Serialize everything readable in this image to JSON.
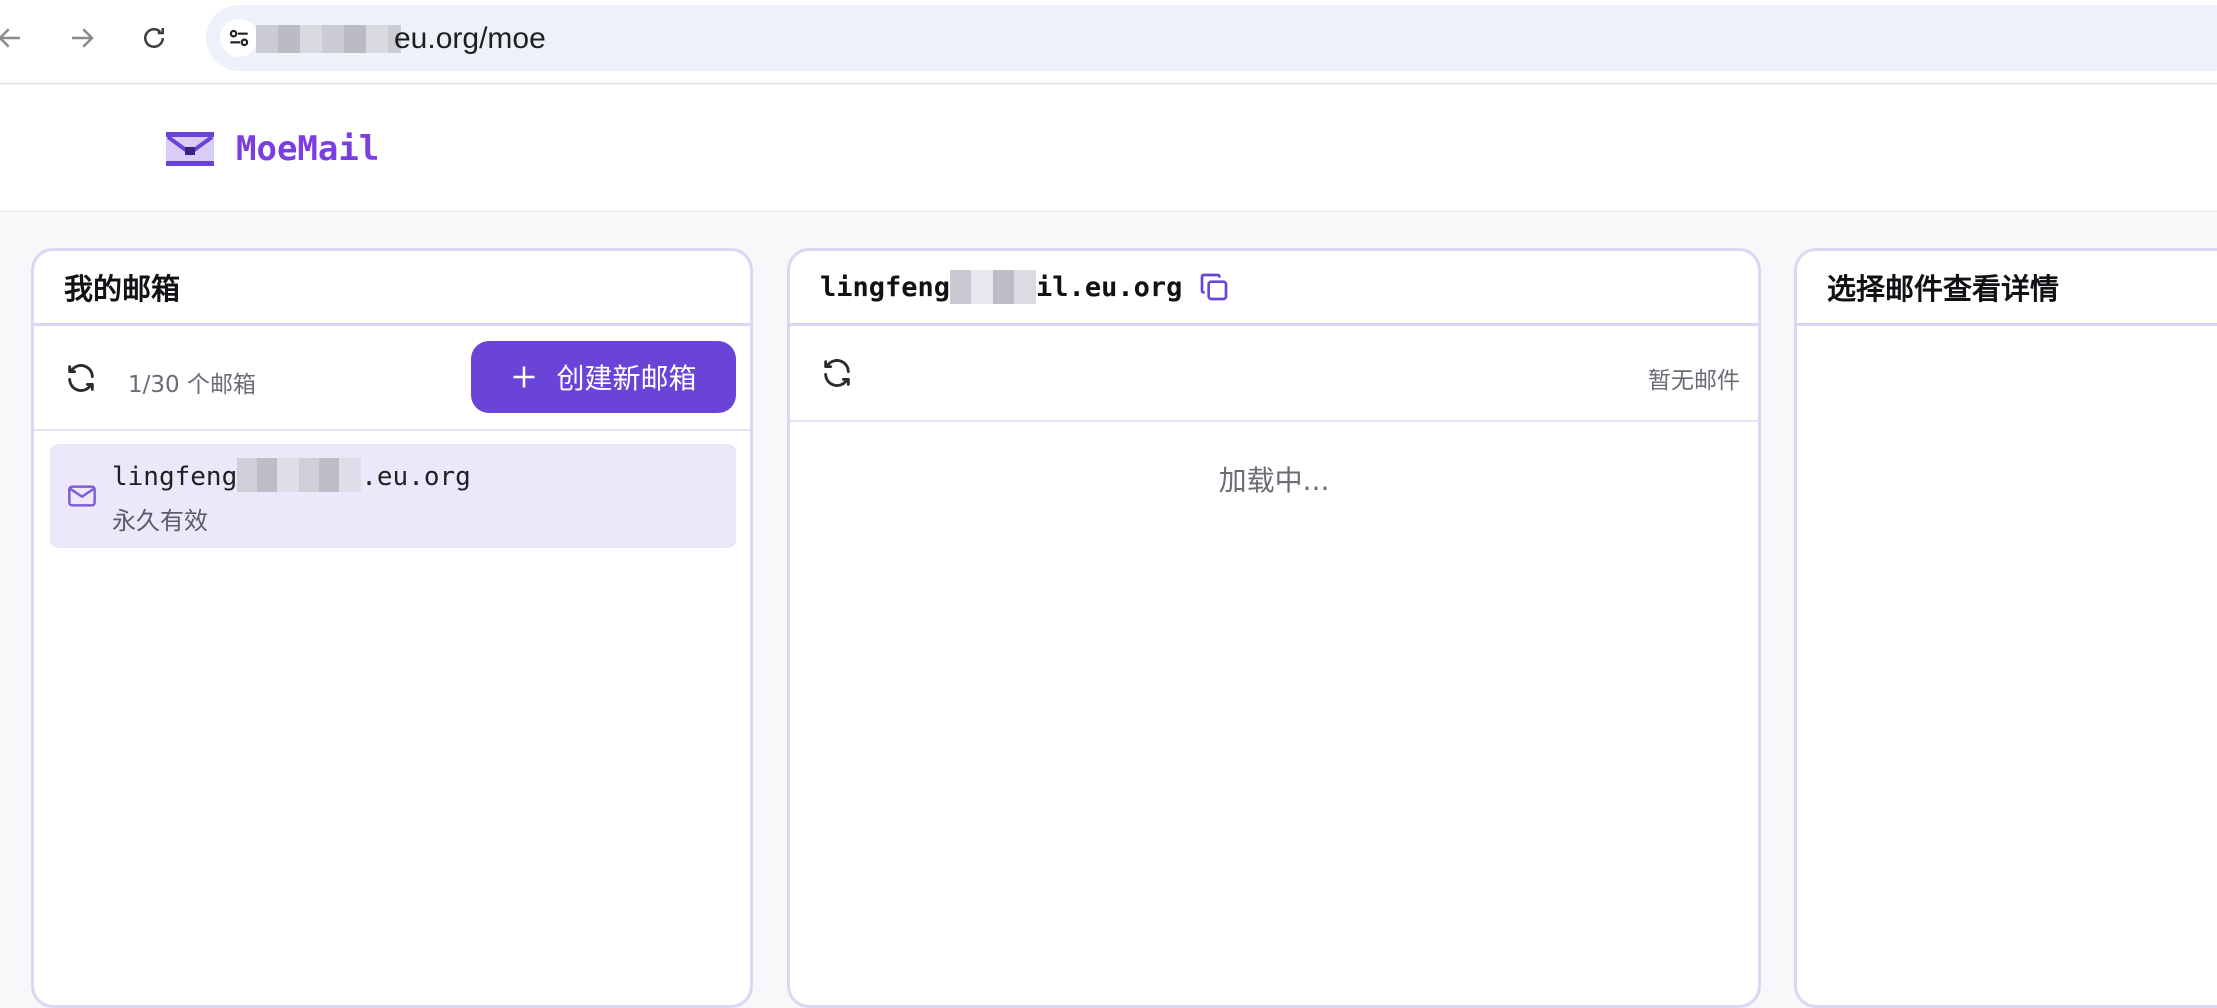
{
  "browser": {
    "url_visible": "eu.org/moe"
  },
  "app": {
    "name": "MoeMail",
    "colors": {
      "accent": "#6a44d6",
      "logo": "#7b3ee0",
      "panel_border": "#dcd5f3"
    }
  },
  "mailboxes_panel": {
    "title": "我的邮箱",
    "count": "1/30 个邮箱",
    "create_button": "创建新邮箱",
    "items": [
      {
        "address_prefix": "lingfeng",
        "address_suffix": ".eu.org",
        "expiry": "永久有效",
        "icon": "mail-icon"
      }
    ]
  },
  "messages_panel": {
    "address_prefix": "lingfeng",
    "address_suffix": "il.eu.org",
    "status": "暂无邮件",
    "loading": "加载中..."
  },
  "detail_panel": {
    "title": "选择邮件查看详情"
  }
}
